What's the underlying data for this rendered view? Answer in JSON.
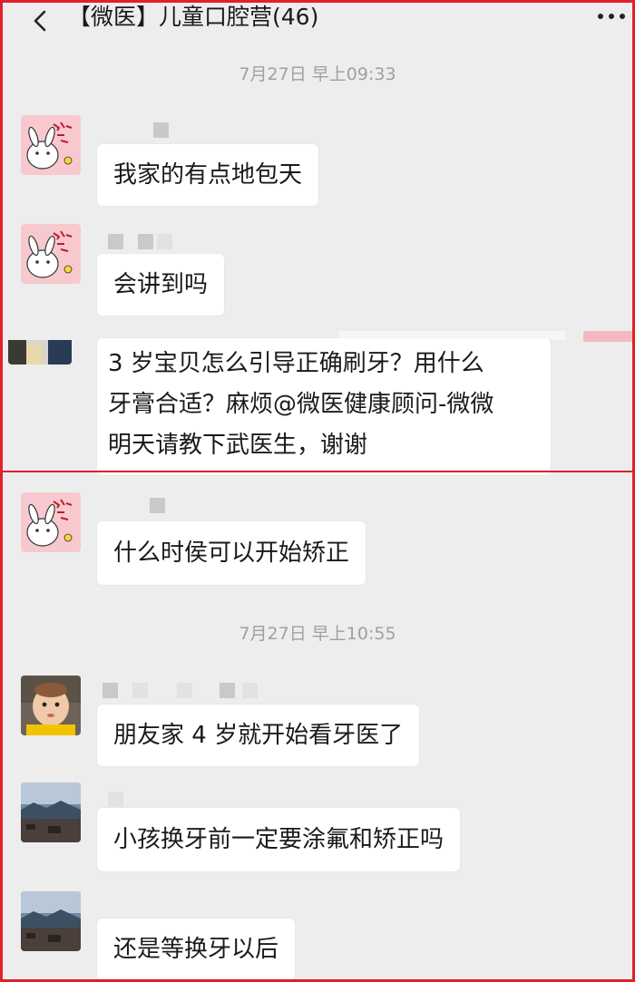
{
  "header": {
    "title": "【微医】儿童口腔营(46)"
  },
  "timestamps": [
    "7月27日 早上09:33",
    "7月27日 早上10:55"
  ],
  "messages": [
    {
      "text": "我家的有点地包天"
    },
    {
      "text": "会讲到吗"
    },
    {
      "lines": [
        "3 岁宝贝怎么引导正确刷牙？用什么",
        "牙膏合适？麻烦@微医健康顾问-微微",
        " 明天请教下武医生，谢谢"
      ]
    },
    {
      "text": "什么时侯可以开始矫正"
    },
    {
      "text": "朋友家 4 岁就开始看牙医了"
    },
    {
      "text": "小孩换牙前一定要涂氟和矫正吗"
    },
    {
      "text": "还是等换牙以后"
    }
  ],
  "icons": {
    "back": "chevron-left-icon",
    "more": "more-icon",
    "avatar_rabbit": "rabbit-sticker-avatar",
    "avatar_baby": "baby-photo-avatar",
    "avatar_landscape": "landscape-photo-avatar"
  },
  "colors": {
    "highlight_border": "#e0202a",
    "chat_background": "#ededed",
    "bubble": "#ffffff"
  }
}
